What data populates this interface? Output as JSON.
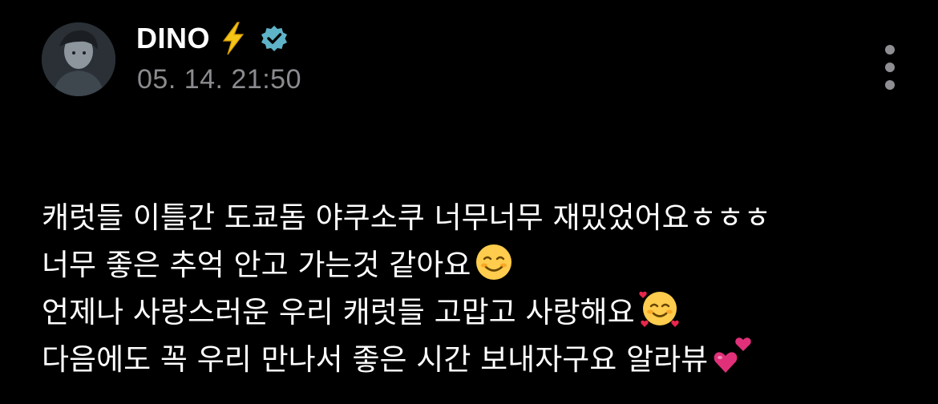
{
  "post": {
    "author": {
      "name": "DINO",
      "name_emoji": "lightning-bolt",
      "verified": true,
      "verified_color": "#5fb3c8"
    },
    "timestamp": "05. 14. 21:50",
    "menu_icon": "more-vertical-icon",
    "lines": [
      {
        "text": "캐럿들 이틀간 도쿄돔 야쿠소쿠 너무너무 재밌었어요ㅎㅎㅎ",
        "emoji": ""
      },
      {
        "text": "너무 좋은 추억 안고 가는것 같아요",
        "emoji": "smiling-face-icon"
      },
      {
        "text": "언제나 사랑스러운 우리 캐럿들 고맙고 사랑해요",
        "emoji": "smiling-face-with-hearts-icon"
      },
      {
        "text": "다음에도 꼭 우리 만나서 좋은 시간 보내자구요 알라뷰",
        "emoji": "two-hearts-icon"
      }
    ]
  },
  "colors": {
    "background": "#000000",
    "text": "#ffffff",
    "timestamp": "#8b8b8f",
    "menu_dots": "#8e8e93",
    "bolt": "#f5c518",
    "heart": "#e1307a"
  }
}
